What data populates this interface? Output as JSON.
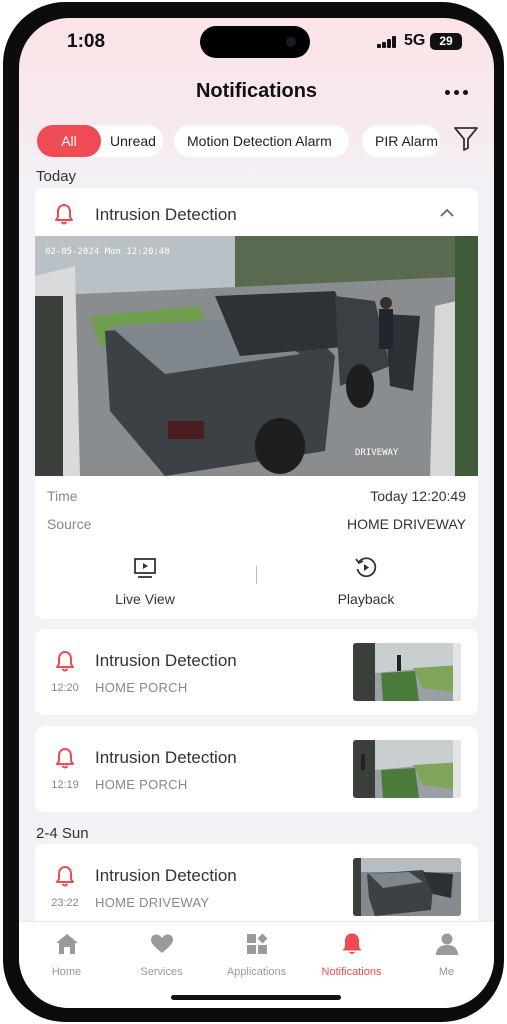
{
  "status": {
    "time": "1:08",
    "network": "5G",
    "battery": "29"
  },
  "header": {
    "title": "Notifications"
  },
  "filters": {
    "all": "All",
    "unread": "Unread",
    "chips": [
      "Motion Detection Alarm",
      "PIR Alarm"
    ]
  },
  "sections": [
    {
      "label": "Today",
      "expanded": {
        "title": "Intrusion Detection",
        "overlay_timestamp": "02-05-2024 Mon 12:20:48",
        "overlay_camera": "DRIVEWAY",
        "time_label": "Time",
        "time_value": "Today 12:20:49",
        "source_label": "Source",
        "source_value": "HOME  DRIVEWAY",
        "live_view": "Live View",
        "playback": "Playback"
      },
      "rows": [
        {
          "title": "Intrusion Detection",
          "time": "12:20",
          "source": "HOME  PORCH"
        },
        {
          "title": "Intrusion Detection",
          "time": "12:19",
          "source": "HOME  PORCH"
        }
      ]
    },
    {
      "label": "2-4 Sun",
      "rows": [
        {
          "title": "Intrusion Detection",
          "time": "23:22",
          "source": "HOME  DRIVEWAY"
        }
      ]
    }
  ],
  "tabs": [
    {
      "label": "Home",
      "icon": "home-icon"
    },
    {
      "label": "Services",
      "icon": "heart-icon"
    },
    {
      "label": "Applications",
      "icon": "apps-icon"
    },
    {
      "label": "Notifications",
      "icon": "bell-icon",
      "active": true
    },
    {
      "label": "Me",
      "icon": "person-icon"
    }
  ],
  "colors": {
    "accent": "#ee4b55",
    "background": "#f1f1f6",
    "card": "#ffffff"
  }
}
